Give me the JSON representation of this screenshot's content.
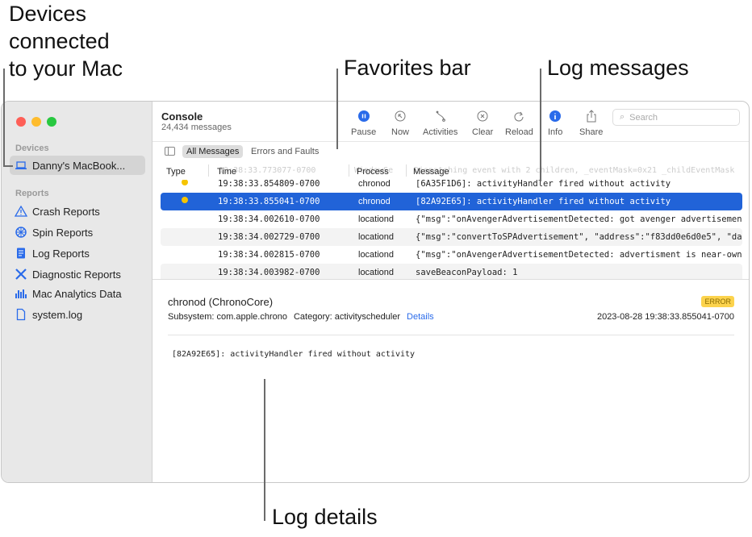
{
  "callouts": {
    "devices": "Devices connected to your Mac",
    "devices_l1": "Devices",
    "devices_l2": "connected",
    "devices_l3": "to your Mac",
    "favorites": "Favorites bar",
    "log_messages": "Log messages",
    "log_details": "Log details"
  },
  "sidebar": {
    "devices_header": "Devices",
    "device": "Danny's MacBook...",
    "reports_header": "Reports",
    "items": [
      {
        "label": "Crash Reports",
        "icon": "warning-icon"
      },
      {
        "label": "Spin Reports",
        "icon": "spin-icon"
      },
      {
        "label": "Log Reports",
        "icon": "document-icon"
      },
      {
        "label": "Diagnostic Reports",
        "icon": "tools-icon"
      },
      {
        "label": "Mac Analytics Data",
        "icon": "chart-icon"
      },
      {
        "label": "system.log",
        "icon": "file-icon"
      }
    ]
  },
  "header": {
    "title": "Console",
    "count": "24,434 messages"
  },
  "toolbar": {
    "pause": "Pause",
    "now": "Now",
    "activities": "Activities",
    "clear": "Clear",
    "reload": "Reload",
    "info": "Info",
    "share": "Share",
    "search_placeholder": "Search"
  },
  "favorites": {
    "all": "All Messages",
    "errors": "Errors and Faults"
  },
  "columns": {
    "type": "Type",
    "time": "Time",
    "process": "Process",
    "message": "Message"
  },
  "ghost_row": {
    "time": "19:38:33.773077-0700",
    "process": "WindowSe",
    "message": "Dispatching event with 2 children, _eventMask=0x21 _childEventMask"
  },
  "rows": [
    {
      "time": "19:38:33.854809-0700",
      "process": "chronod",
      "message": "[6A35F1D6]: activityHandler fired without activity",
      "dot": true
    },
    {
      "time": "19:38:33.855041-0700",
      "process": "chronod",
      "message": "[82A92E65]: activityHandler fired without activity",
      "dot": true,
      "selected": true
    },
    {
      "time": "19:38:34.002610-0700",
      "process": "locationd",
      "message": "{\"msg\":\"onAvengerAdvertisementDetected: got avenger advertisement"
    },
    {
      "time": "19:38:34.002729-0700",
      "process": "locationd",
      "message": "{\"msg\":\"convertToSPAdvertisement\", \"address\":\"f83dd0e6d0e5\", \"da"
    },
    {
      "time": "19:38:34.002815-0700",
      "process": "locationd",
      "message": "{\"msg\":\"onAvengerAdvertisementDetected: advertisment is near-own"
    },
    {
      "time": "19:38:34.003982-0700",
      "process": "locationd",
      "message": "saveBeaconPayload: 1"
    }
  ],
  "detail": {
    "title": "chronod (ChronoCore)",
    "badge": "ERROR",
    "subsystem": "Subsystem: com.apple.chrono",
    "category": "Category: activityscheduler",
    "details_link": "Details",
    "timestamp": "2023-08-28 19:38:33.855041-0700",
    "message": "[82A92E65]: activityHandler fired without activity"
  },
  "colors": {
    "accent": "#2163d8",
    "warning": "#f5c400"
  }
}
